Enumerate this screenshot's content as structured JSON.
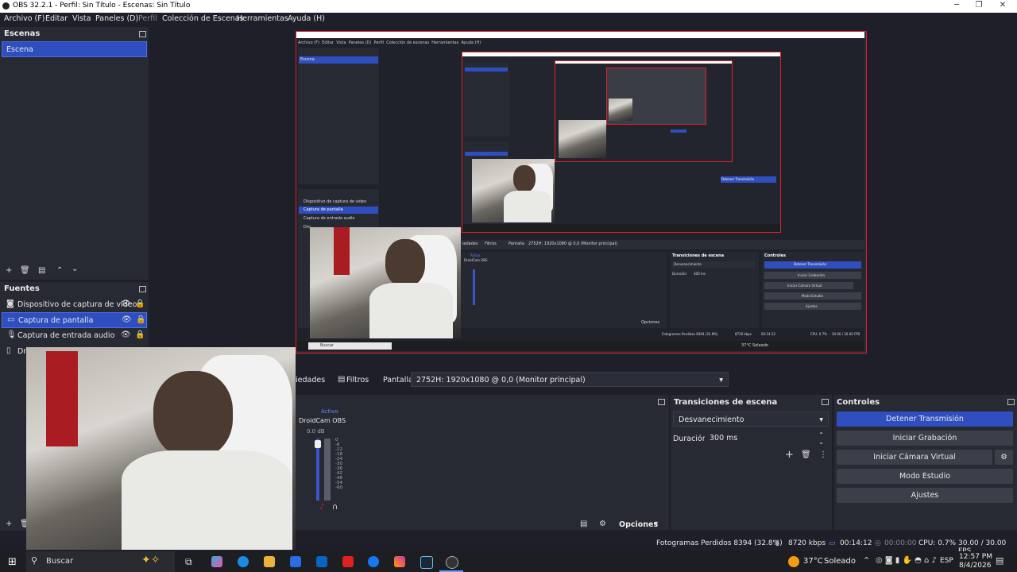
{
  "window": {
    "title": "OBS 32.2.1 - Perfil: Sin Título - Escenas: Sin Título"
  },
  "menu": {
    "items": [
      "Archivo (F)",
      "Editar",
      "Vista",
      "Paneles (D)",
      "Perfil",
      "Colección de Escenas",
      "Herramientas",
      "Ayuda (H)"
    ]
  },
  "scenes": {
    "header": "Escenas",
    "items": [
      "Escena"
    ]
  },
  "sources": {
    "header": "Fuentes",
    "items": [
      "Dispositivo de captura de video",
      "Captura de pantalla",
      "Captura de entrada audio",
      "Dro"
    ]
  },
  "properties_bar": {
    "tab_properties": "iedades",
    "tab_filters": "Filtros",
    "source_label": "Pantalla",
    "display_value": "2752H: 1920x1080 @ 0,0 (Monitor principal)"
  },
  "mixer": {
    "active_label": "Activo",
    "channel": "DroidCam OBS",
    "level": "0.0 dB",
    "ticks": [
      "0",
      "-6",
      "-12",
      "-18",
      "-24",
      "-30",
      "-36",
      "-42",
      "-48",
      "-54",
      "-60"
    ],
    "options_label": "Opciones"
  },
  "transitions": {
    "header": "Transiciones de escena",
    "selected": "Desvanecimiento",
    "duration_label": "Duración",
    "duration_value": "300 ms"
  },
  "controls": {
    "header": "Controles",
    "stop_stream": "Detener Transmisión",
    "start_record": "Iniciar Grabación",
    "virtual_cam": "Iniciar Cámara Virtual",
    "studio_mode": "Modo Estudio",
    "settings": "Ajustes"
  },
  "statusbar": {
    "dropped": "Fotogramas Perdidos 8394 (32.8%)",
    "bitrate": "8720 kbps",
    "stream_time": "00:14:12",
    "rec_time": "00:00:00",
    "cpu": "CPU: 0.7%",
    "fps": "30.00 / 30.00 FPS"
  },
  "taskbar": {
    "search_placeholder": "Buscar",
    "weather": "37°C",
    "weather_text": "Soleado",
    "lang": "ESP",
    "time": "12:57 PM",
    "date": "8/4/2026"
  },
  "preview_nested": {
    "menu_small": [
      "Archivo (F)",
      "Editar",
      "Vista",
      "Paneles (D)",
      "Perfil",
      "Colección de escenas",
      "Herramientas",
      "Ayuda (H)"
    ],
    "scene_small": "Escena",
    "sources_small": [
      "Dispositivo de captura de video",
      "Captura de pantalla",
      "Captura de entrada audio",
      "Dro"
    ],
    "display_small": "2752H: 1920x1080 @ 0,0 (Monitor principal)",
    "transitions_small": "Transiciones de escena",
    "controls_small": "Controles",
    "stop_small": "Detener Transmisión",
    "rec_small": "Iniciar Grabación",
    "vcam_small": "Iniciar Cámara Virtual",
    "studio_small": "Modo Estudio",
    "settings_small": "Ajustes",
    "fade_small": "Desvanecimiento",
    "dur_small": "Duración",
    "dur_val_small": "300 ms",
    "dropped_small": "Fotogramas Perdidos 8394 (32.8%)",
    "bitrate_small": "8720 kbps",
    "time_small": "00:14:12",
    "cpu_small": "CPU: 0.7%",
    "fps_small": "30.00 / 30.00 FPS",
    "search_small": "Buscar",
    "weather_small": "37°C  Soleado",
    "active_small": "Activo",
    "cam_small": "DroidCam OBS",
    "options_small": "Opciones",
    "filters_small": "Filtros",
    "pantalla_small": "Pantalla",
    "props_small": "iedades"
  },
  "colors": {
    "accent": "#2f4ec0",
    "selection_border": "#e01e2e",
    "background": "#1e1f29",
    "panel": "#272a33"
  }
}
